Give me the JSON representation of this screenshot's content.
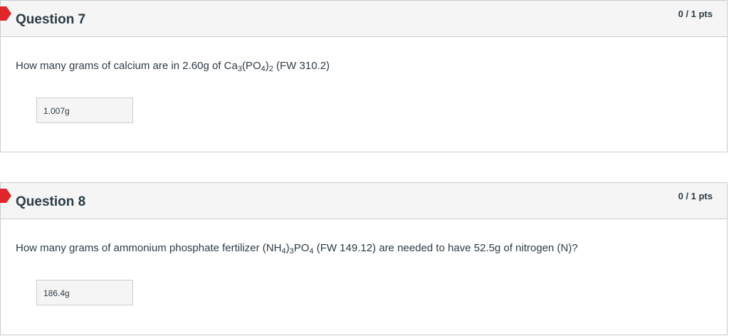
{
  "questions": [
    {
      "title": "Question 7",
      "points": "0 / 1 pts",
      "text": {
        "t1": "How many grams of calcium are in 2.60g of Ca",
        "s1": "3",
        "t2": "(PO",
        "s2": "4",
        "t3": ")",
        "s3": "2",
        "t4": " (FW 310.2)"
      },
      "answer": "1.007g"
    },
    {
      "title": "Question 8",
      "points": "0 / 1 pts",
      "text": {
        "t1": "How many grams of ammonium phosphate fertilizer (NH",
        "s1": "4",
        "t2": ")",
        "s2": "3",
        "t3": "PO",
        "s3": "4",
        "t4": " (FW 149.12) are needed to have 52.5g of nitrogen (N)?"
      },
      "answer": "186.4g"
    }
  ],
  "colors": {
    "flag": "#e0252b",
    "header_bg": "#f5f5f5",
    "border": "#c7cdd1",
    "text": "#2d3b45"
  },
  "icons": {
    "flag": "incorrect-flag-icon"
  }
}
